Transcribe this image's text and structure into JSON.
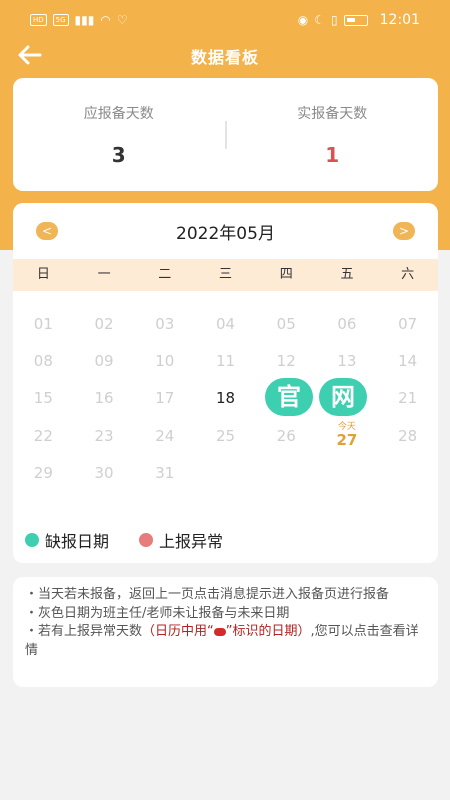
{
  "status_bar": {
    "badge1": "HD",
    "badge2": "5G",
    "time": "12:01"
  },
  "header": {
    "back_icon": "arrow-left-icon",
    "title": "数据看板"
  },
  "summary": {
    "expected_label": "应报备天数",
    "expected_value": "3",
    "actual_label": "实报备天数",
    "actual_value": "1",
    "actual_color": "#d9534f"
  },
  "calendar": {
    "month_label": "2022年05月",
    "prev_icon": "chevron-left-icon",
    "next_icon": "chevron-right-icon",
    "prev_glyph": "<",
    "next_glyph": ">",
    "weekdays": [
      "日",
      "一",
      "二",
      "三",
      "四",
      "五",
      "六"
    ],
    "days": [
      "01",
      "02",
      "03",
      "04",
      "05",
      "06",
      "07",
      "08",
      "09",
      "10",
      "11",
      "12",
      "13",
      "14",
      "15",
      "16",
      "17",
      "18",
      "19",
      "20",
      "21",
      "22",
      "23",
      "24",
      "25",
      "26",
      "27",
      "28",
      "29",
      "30",
      "31"
    ],
    "today_label": "今天",
    "today_day": "27",
    "missing_days": [
      "19",
      "20"
    ],
    "accent_color": "#f4b24a"
  },
  "legend": {
    "missing_label": "缺报日期",
    "missing_color": "#3ecfb0",
    "abnormal_label": "上报异常",
    "abnormal_color": "#e87b7b"
  },
  "watermark": {
    "chars": [
      "官",
      "网"
    ]
  },
  "notes": {
    "line1": "・当天若未报备，返回上一页点击消息提示进入报备页进行报备",
    "line2": "・灰色日期为班主任/老师未让报备与未来日期",
    "line3_a": "・若有上报异常天数",
    "line3_red_a": "（日历中用“",
    "line3_red_b": "”标识的日期）",
    "line3_b": ",您可以点击查看详情"
  }
}
